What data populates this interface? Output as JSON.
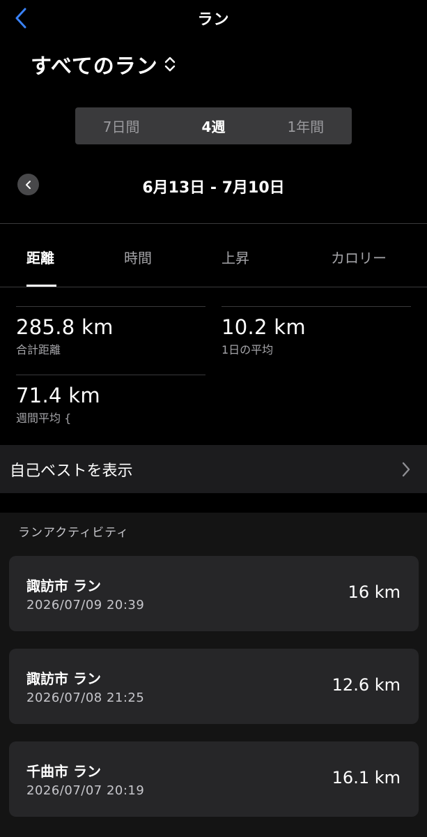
{
  "header": {
    "title": "ラン",
    "back_icon": "chevron-left-icon"
  },
  "filter": {
    "label": "すべてのラン",
    "icon": "sort-updown-icon"
  },
  "range_selector": {
    "options": [
      "7日間",
      "4週",
      "1年間"
    ],
    "selected": "4週"
  },
  "date_range": {
    "label": "6月13日 - 7月10日"
  },
  "metric_tabs": {
    "items": [
      "距離",
      "時間",
      "上昇",
      "カロリー"
    ],
    "selected": "距離"
  },
  "stats": [
    {
      "value": "285.8 km",
      "label": "合計距離"
    },
    {
      "value": "10.2 km",
      "label": "1日の平均"
    },
    {
      "value": "71.4 km",
      "label": "週間平均 {"
    }
  ],
  "personal_records": {
    "label": "自己ベストを表示"
  },
  "activities": {
    "section_title": "ランアクティビティ",
    "items": [
      {
        "name": "諏訪市 ラン",
        "date": "2026/07/09 20:39",
        "distance": "16 km"
      },
      {
        "name": "諏訪市 ラン",
        "date": "2026/07/08 21:25",
        "distance": "12.6 km"
      },
      {
        "name": "千曲市 ラン",
        "date": "2026/07/07 20:19",
        "distance": "16.1 km"
      }
    ]
  },
  "colors": {
    "accent_blue": "#3a82f7",
    "background": "#000000",
    "card": "#262628",
    "muted_text": "#a5a5a9"
  }
}
